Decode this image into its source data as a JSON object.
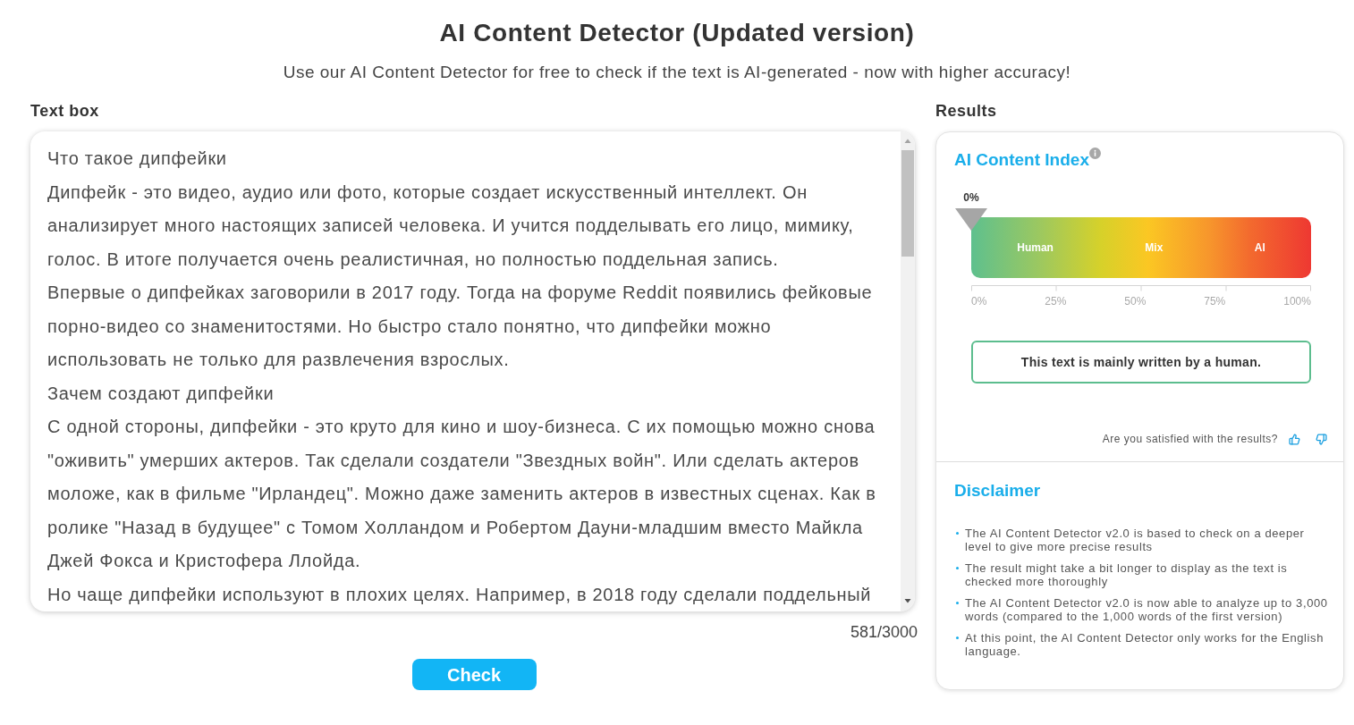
{
  "header": {
    "title": "AI Content Detector (Updated version)",
    "subtitle": "Use our AI Content Detector for free to check if the text is AI-generated - now with higher accuracy!"
  },
  "text_box": {
    "label": "Text box",
    "value": [
      "Что такое дипфейки",
      "Дипфейк - это видео, аудио или фото, которые создает искусственный интеллект. Он анализирует много настоящих записей человека. И учится подделывать его лицо, мимику, голос. В итоге получается очень реалистичная, но полностью поддельная запись.",
      "Впервые о дипфейках заговорили в 2017 году. Тогда на форуме Reddit появились фейковые порно-видео со знаменитостями. Но быстро стало понятно, что дипфейки можно использовать не только для развлечения взрослых.",
      "Зачем создают дипфейки",
      "С одной стороны, дипфейки - это круто для кино и шоу-бизнеса. С их помощью можно снова \"оживить\" умерших актеров. Так сделали создатели \"Звездных войн\". Или сделать актеров моложе, как в фильме \"Ирландец\". Можно даже заменить актеров в известных сценах. Как в ролике \"Назад в будущее\" с Томом Холландом и Робертом Дауни-младшим вместо Майкла Джей Фокса и Кристофера Ллойда.",
      "Но чаще дипфейки используют в плохих целях. Например, в 2018 году сделали поддельный"
    ],
    "counter": "581/3000",
    "check_button": "Check"
  },
  "results": {
    "label": "Results",
    "ai_content_index": {
      "title": "AI Content Index",
      "reading": "0%",
      "level": 0,
      "zones": [
        "Human",
        "Mix",
        "AI"
      ],
      "scale": [
        "0%",
        "25%",
        "50%",
        "75%",
        "100%"
      ],
      "verdict": "This text is mainly written by a human."
    },
    "feedback": {
      "question": "Are you satisfied with the results?"
    },
    "disclaimer": {
      "title": "Disclaimer",
      "items": [
        "The AI Content Detector v2.0 is based to check on a deeper level to give more precise results",
        "The result might take a bit longer to display as the text is checked more thoroughly",
        "The AI Content Detector v2.0 is now able to analyze up to 3,000 words (compared to the 1,000 words of the first version)",
        "At this point, the AI Content Detector only works for the English language."
      ]
    }
  }
}
